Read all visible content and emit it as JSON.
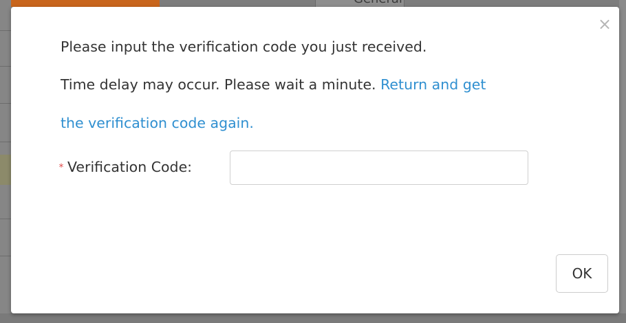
{
  "background": {
    "tab_label": "General"
  },
  "dialog": {
    "close_glyph": "×",
    "line1": "Please input the verification code you just received.",
    "line2_text": "Time delay may occur. Please wait a minute.",
    "link_part1": "Return and get",
    "link_part2": "the verification code again.",
    "required_mark": "*",
    "field_label": "Verification Code:",
    "code_value": "",
    "ok_label": "OK"
  },
  "colors": {
    "link": "#2f8fd0",
    "required": "#e04b4b",
    "backdrop": "#7d7d7d"
  }
}
